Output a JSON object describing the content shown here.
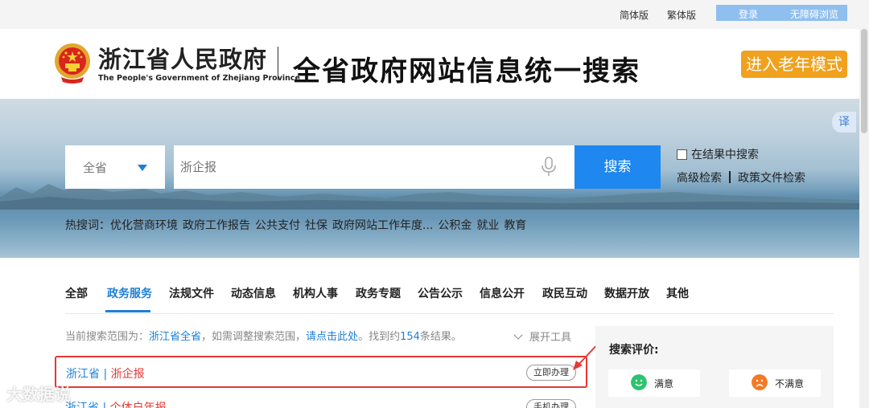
{
  "topbar": {
    "simplified": "简体版",
    "traditional": "繁体版",
    "login": "登录",
    "accessible": "无障碍浏览"
  },
  "header": {
    "gov_name_cn": "浙江省人民政府",
    "gov_name_en": "The People's Government of Zhejiang Province",
    "site_title": "全省政府网站信息统一搜索",
    "elder_mode": "进入老年模式"
  },
  "banner": {
    "translate": "译"
  },
  "search": {
    "scope": "全省",
    "placeholder": "浙企报",
    "button": "搜索",
    "within_results": "在结果中搜索",
    "advanced": "高级检索",
    "policy": "政策文件检索"
  },
  "hot": {
    "label": "热搜词：",
    "items": [
      "优化营商环境",
      "政府工作报告",
      "公共支付",
      "社保",
      "政府网站工作年度...",
      "公积金",
      "就业",
      "教育"
    ]
  },
  "tabs": [
    "全部",
    "政务服务",
    "法规文件",
    "动态信息",
    "机构人事",
    "政务专题",
    "公告公示",
    "信息公开",
    "政民互动",
    "数据开放",
    "其他"
  ],
  "info": {
    "prefix": "当前搜索范围为：",
    "scope": "浙江省全省",
    "middle": "，如需调整搜索范围，",
    "link": "请点击此处",
    "found_prefix": "。找到约",
    "count": "154",
    "found_suffix": "条结果。",
    "expand": "展开工具"
  },
  "results": [
    {
      "region": "浙江省",
      "sep": " | ",
      "name": "浙企报",
      "action": "立即办理"
    },
    {
      "region": "浙江省",
      "sep": " | ",
      "name": "个体户年报",
      "action": "手机办理"
    }
  ],
  "rating": {
    "title": "搜索评价:",
    "good": "满意",
    "bad": "不满意"
  },
  "watermark": "大数据说",
  "colors": {
    "accent": "#1e7fd6",
    "elder": "#f0a11d",
    "highlight_red": "#e53935",
    "smile": "#2ec36f",
    "frown": "#f07b26"
  }
}
